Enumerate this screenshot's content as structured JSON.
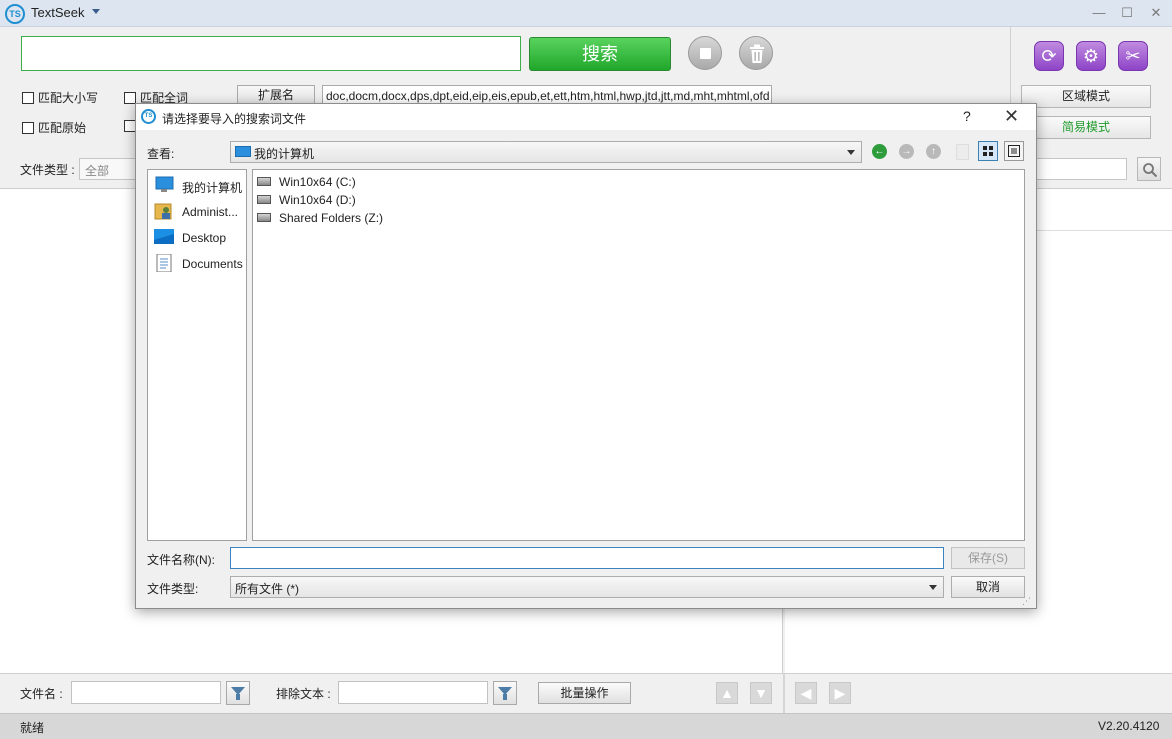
{
  "app": {
    "logo_text": "TS",
    "title": "TextSeek",
    "minimize": "—",
    "maximize": "☐",
    "close": "✕"
  },
  "search": {
    "query": "",
    "button_label": "搜索"
  },
  "options": {
    "match_case": "匹配大小写",
    "match_whole": "匹配全词",
    "match_original": "匹配原始",
    "ext_label": "扩展名",
    "ext_value": "doc,docm,docx,dps,dpt,eid,eip,eis,epub,et,ett,htm,html,hwp,jtd,jtt,md,mht,mhtml,ofd"
  },
  "modes": {
    "region_mode": "区域模式",
    "simple_mode": "简易模式"
  },
  "filter": {
    "file_type_label": "文件类型 :",
    "file_type_value": "全部"
  },
  "bottom": {
    "filename_label": "文件名 :",
    "exclude_label": "排除文本 :",
    "batch_label": "批量操作"
  },
  "status": {
    "text": "就绪",
    "version": "V2.20.4120"
  },
  "dialog": {
    "title": "请选择要导入的搜索词文件",
    "help": "?",
    "close": "✕",
    "lookin_label": "查看:",
    "lookin_value": "我的计算机",
    "sidebar": [
      {
        "label": "我的计算机"
      },
      {
        "label": "Administ..."
      },
      {
        "label": "Desktop"
      },
      {
        "label": "Documents"
      }
    ],
    "files": [
      {
        "label": "Win10x64 (C:)"
      },
      {
        "label": "Win10x64 (D:)"
      },
      {
        "label": "Shared Folders (Z:)"
      }
    ],
    "filename_label": "文件名称(N):",
    "filename_value": "",
    "save_label": "保存(S)",
    "filetype_label": "文件类型:",
    "filetype_value": "所有文件 (*)",
    "cancel_label": "取消"
  },
  "colors": {
    "accent_green": "#20a72a",
    "accent_purple": "#8e44c7",
    "accent_blue": "#1f8fd1"
  }
}
